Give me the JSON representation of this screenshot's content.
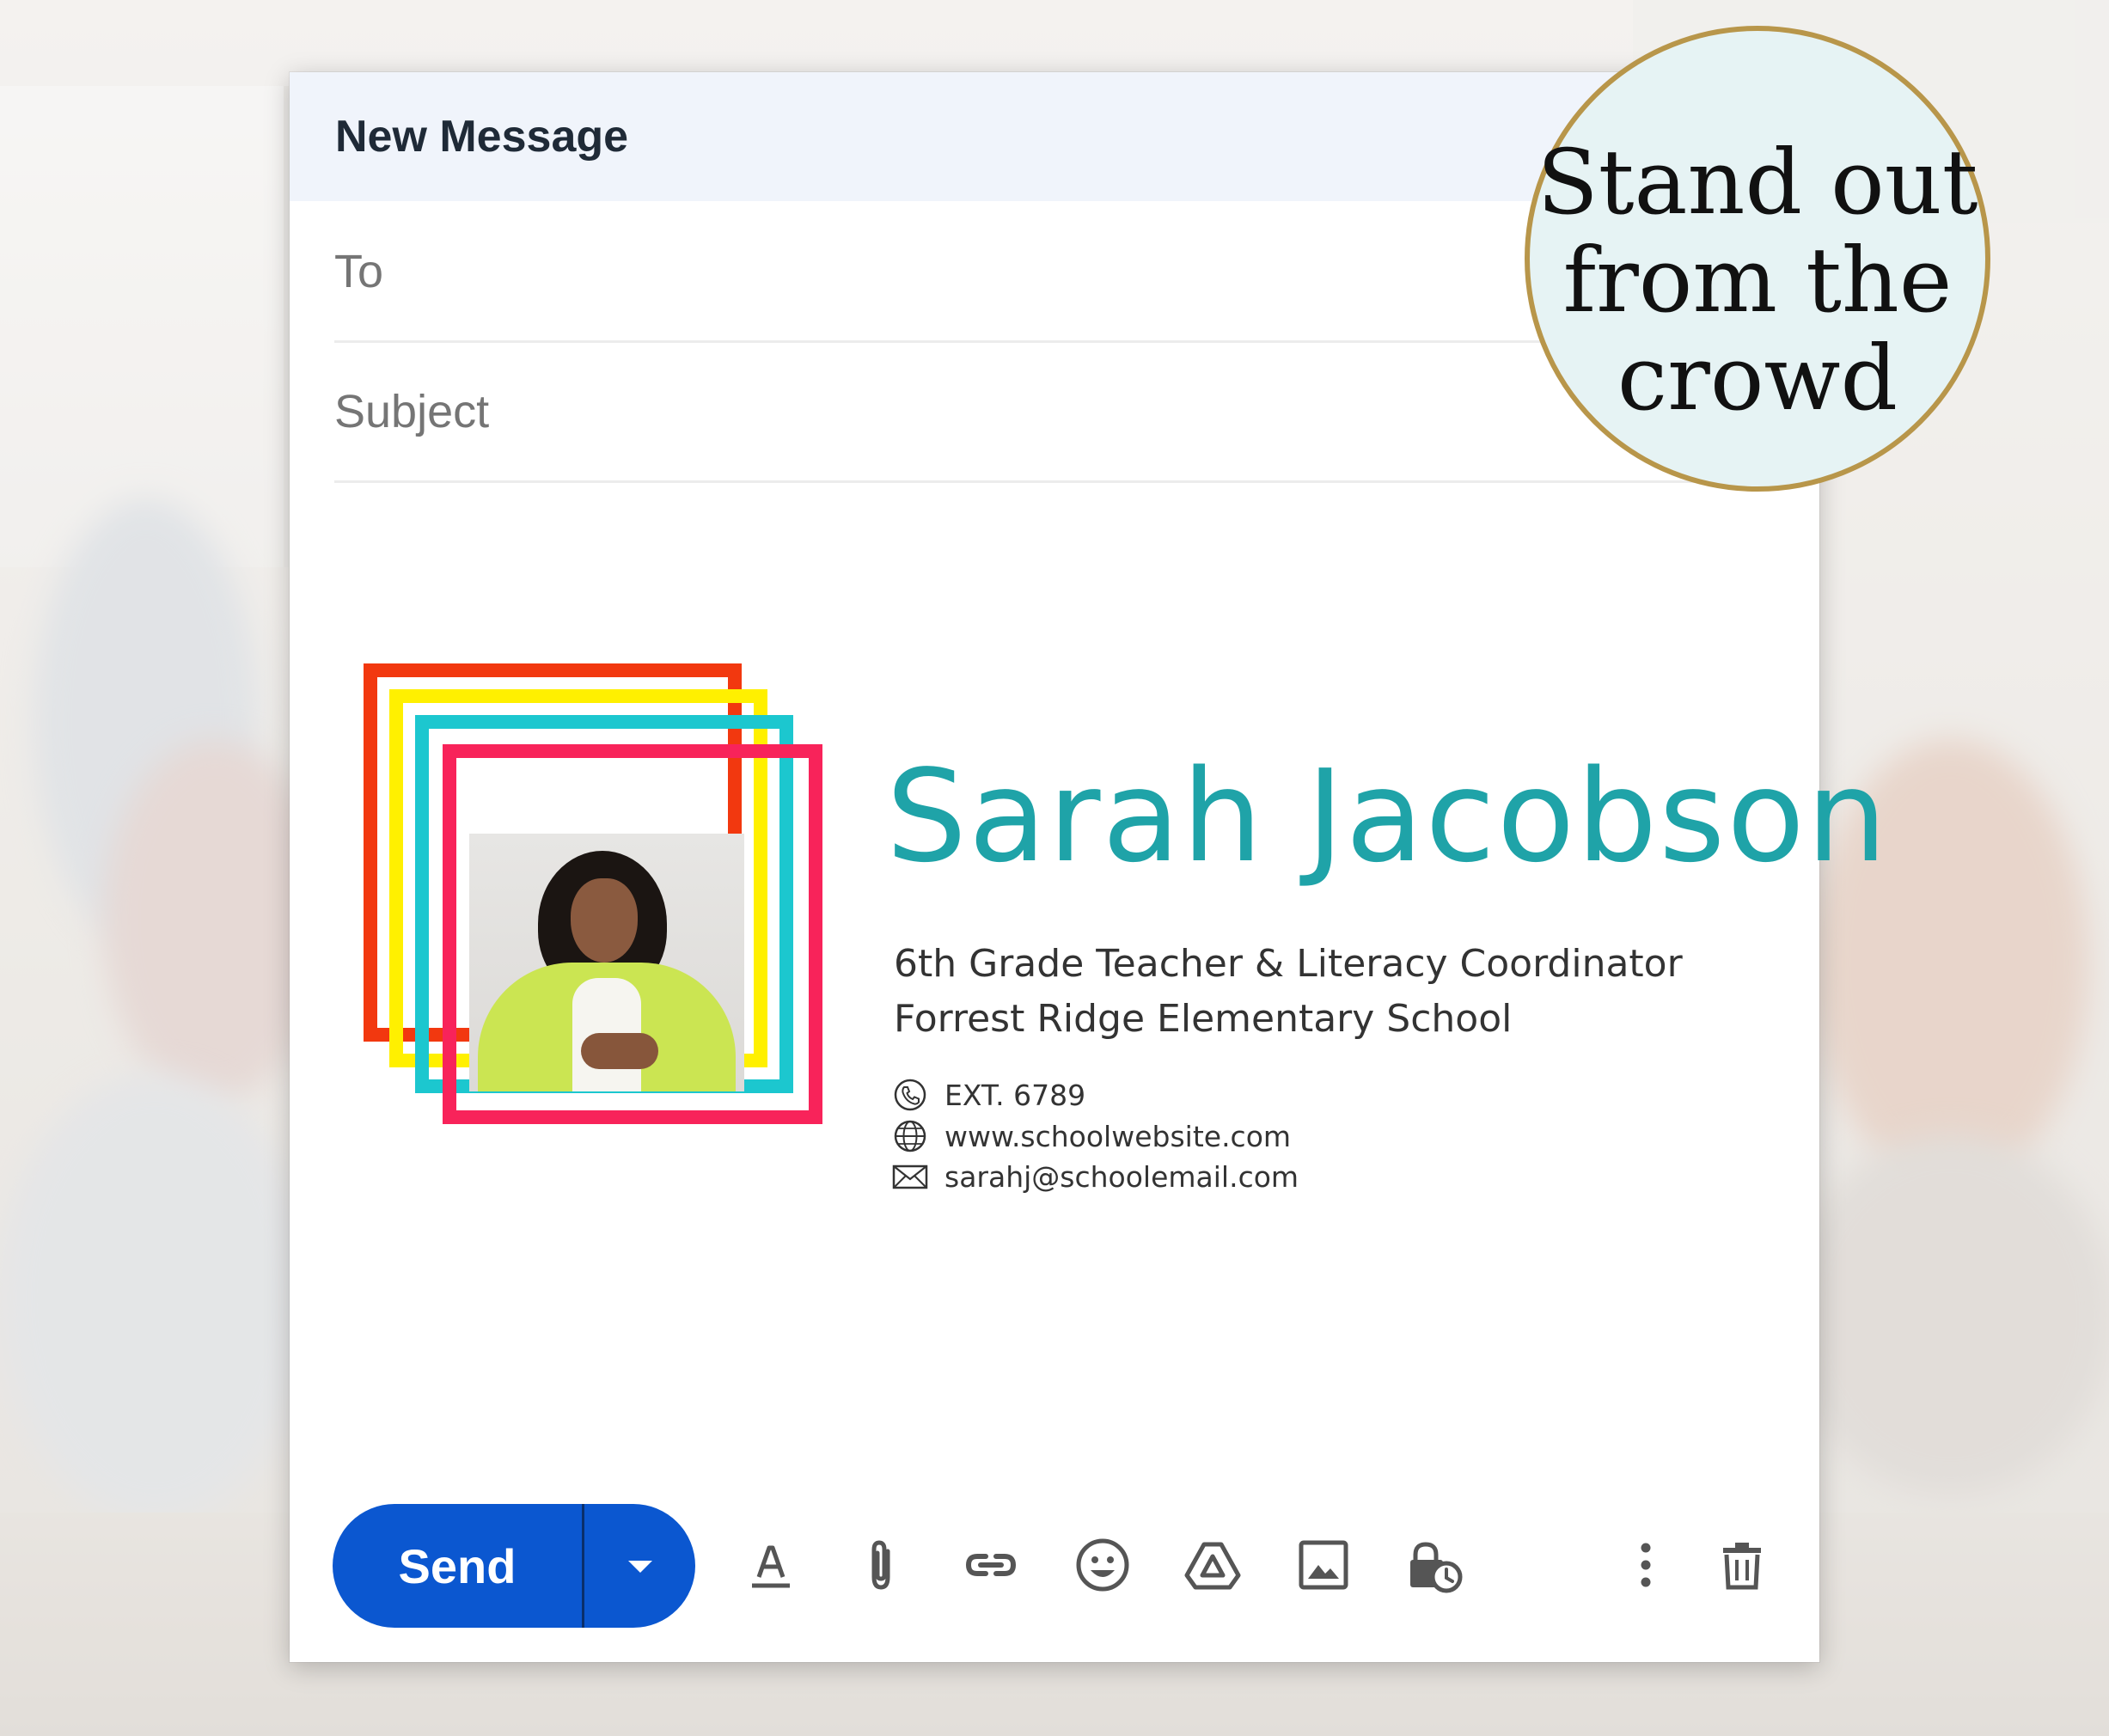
{
  "compose": {
    "title": "New Message",
    "to_placeholder": "To",
    "subject_placeholder": "Subject"
  },
  "signature": {
    "name": "Sarah Jacobson",
    "role": "6th Grade Teacher & Literacy Coordinator",
    "school": "Forrest Ridge Elementary School",
    "phone": "EXT. 6789",
    "website": "www.schoolwebsite.com",
    "email": "sarahj@schoolemail.com",
    "frame_colors": [
      "#f2380f",
      "#fff000",
      "#1cc7cf",
      "#f8235a"
    ],
    "name_color": "#1fa3a8"
  },
  "toolbar": {
    "send_label": "Send",
    "send_color": "#0b57d0",
    "icons": [
      "more-send-options-icon",
      "formatting-icon",
      "attach-icon",
      "link-icon",
      "emoji-icon",
      "drive-icon",
      "photo-icon",
      "confidential-mode-icon",
      "more-options-icon",
      "trash-icon"
    ]
  },
  "badge": {
    "line1": "Stand out",
    "line2": "from the",
    "line3": "crowd"
  }
}
